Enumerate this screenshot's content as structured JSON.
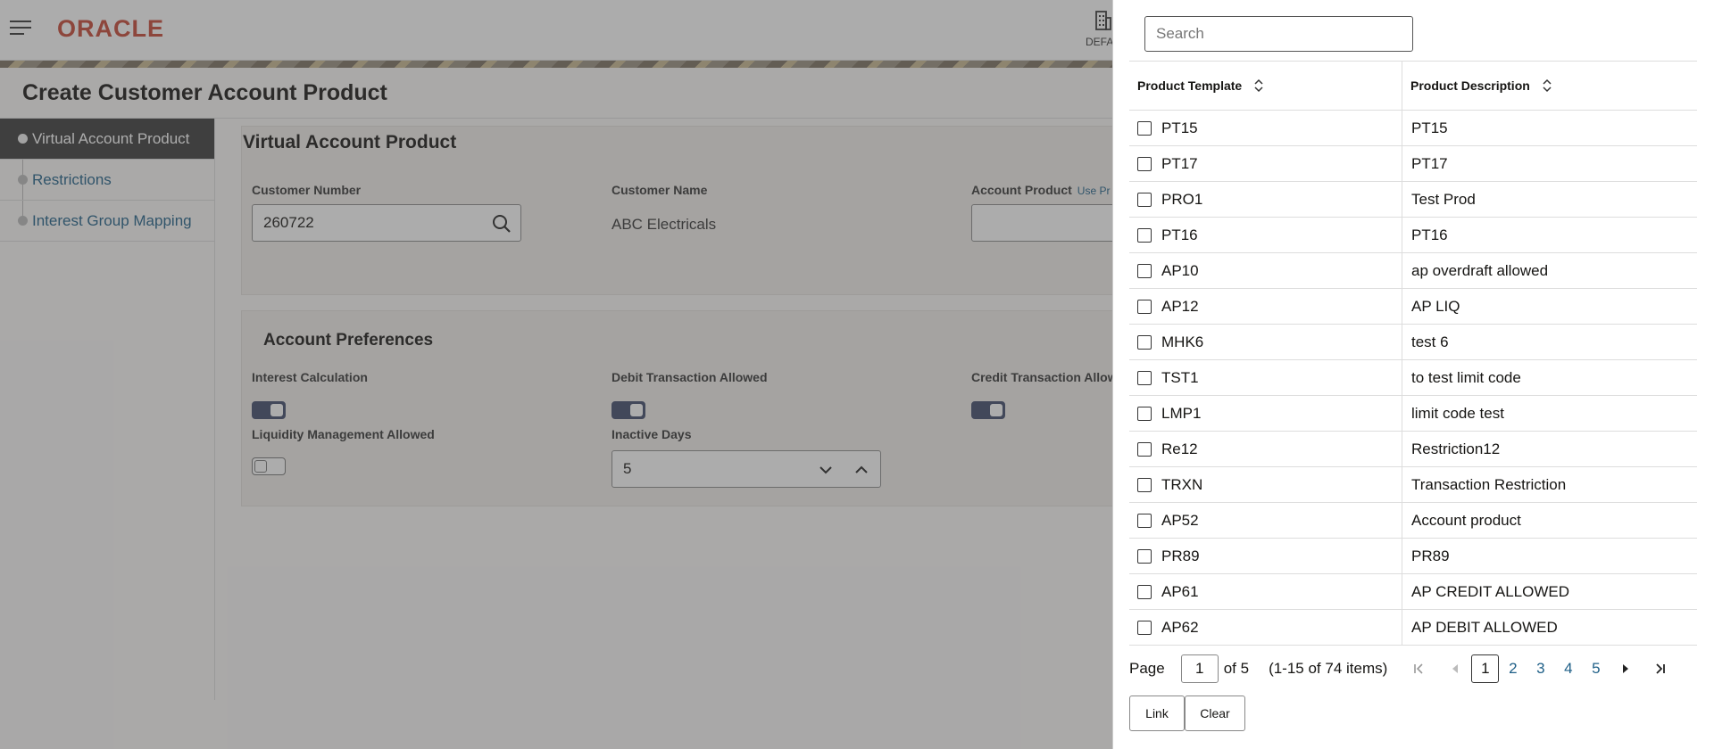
{
  "app": {
    "brand": "ORACLE",
    "branch_label": "DEFAU",
    "page_title": "Create Customer Account Product"
  },
  "sidenav": {
    "items": [
      {
        "label": "Virtual Account Product",
        "active": true
      },
      {
        "label": "Restrictions",
        "active": false
      },
      {
        "label": "Interest Group Mapping",
        "active": false
      }
    ]
  },
  "main": {
    "section_title": "Virtual Account Product",
    "customer_number_label": "Customer Number",
    "customer_number_value": "260722",
    "customer_name_label": "Customer Name",
    "customer_name_value": "ABC Electricals",
    "account_product_label": "Account Product",
    "account_product_hint": "Use Pr",
    "preferences_title": "Account Preferences",
    "interest_calculation_label": "Interest Calculation",
    "debit_allowed_label": "Debit Transaction Allowed",
    "credit_allowed_label": "Credit Transaction Allow",
    "liquidity_label": "Liquidity Management Allowed",
    "inactive_days_label": "Inactive Days",
    "inactive_days_value": "5"
  },
  "drawer": {
    "search_placeholder": "Search",
    "columns": [
      "Product Template",
      "Product Description"
    ],
    "rows": [
      {
        "template": "PT15",
        "description": "PT15"
      },
      {
        "template": "PT17",
        "description": "PT17"
      },
      {
        "template": "PRO1",
        "description": "Test Prod"
      },
      {
        "template": "PT16",
        "description": "PT16"
      },
      {
        "template": "AP10",
        "description": "ap overdraft allowed"
      },
      {
        "template": "AP12",
        "description": "AP LIQ"
      },
      {
        "template": "MHK6",
        "description": "test 6"
      },
      {
        "template": "TST1",
        "description": "to test limit code"
      },
      {
        "template": "LMP1",
        "description": "limit code test"
      },
      {
        "template": "Re12",
        "description": "Restriction12"
      },
      {
        "template": "TRXN",
        "description": "Transaction Restriction"
      },
      {
        "template": "AP52",
        "description": "Account product"
      },
      {
        "template": "PR89",
        "description": "PR89"
      },
      {
        "template": "AP61",
        "description": "AP CREDIT ALLOWED"
      },
      {
        "template": "AP62",
        "description": "AP DEBIT ALLOWED"
      }
    ],
    "pager": {
      "page_label": "Page",
      "current_page": "1",
      "of_label": "of 5",
      "range_label": "(1-15 of 74 items)",
      "pages": [
        "1",
        "2",
        "3",
        "4",
        "5"
      ]
    },
    "link_label": "Link",
    "clear_label": "Clear"
  },
  "colors": {
    "brand": "#c74634",
    "link": "#1e5f87",
    "toggle_on": "#3f4a6b"
  }
}
